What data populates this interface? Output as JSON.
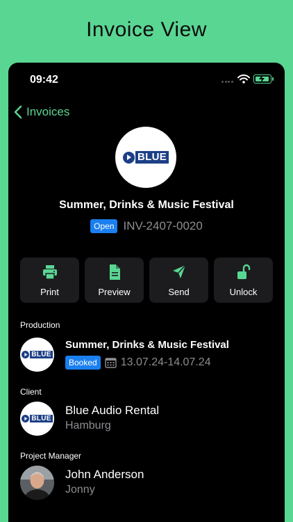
{
  "headline": "Invoice View",
  "status_bar": {
    "time": "09:42"
  },
  "nav": {
    "back_label": "Invoices"
  },
  "invoice": {
    "title": "Summer, Drinks & Music Festival",
    "status_badge": "Open",
    "number": "INV-2407-0020",
    "logo_text": "BLUE"
  },
  "actions": [
    {
      "label": "Print",
      "icon": "printer-icon"
    },
    {
      "label": "Preview",
      "icon": "document-icon"
    },
    {
      "label": "Send",
      "icon": "send-icon"
    },
    {
      "label": "Unlock",
      "icon": "unlock-icon"
    }
  ],
  "production": {
    "section_label": "Production",
    "title": "Summer, Drinks & Music Festival",
    "badge": "Booked",
    "date_range": "13.07.24-14.07.24",
    "logo_text": "BLUE"
  },
  "client": {
    "section_label": "Client",
    "name": "Blue Audio Rental",
    "city": "Hamburg",
    "logo_text": "BLUE"
  },
  "project_manager": {
    "section_label": "Project Manager",
    "name": "John Anderson",
    "nickname": "Jonny"
  },
  "colors": {
    "background": "#5ad693",
    "accent": "#5ad693",
    "badge_blue": "#1a7ff0",
    "tile": "#1c1c1e",
    "logo_blue": "#1c3f86"
  }
}
